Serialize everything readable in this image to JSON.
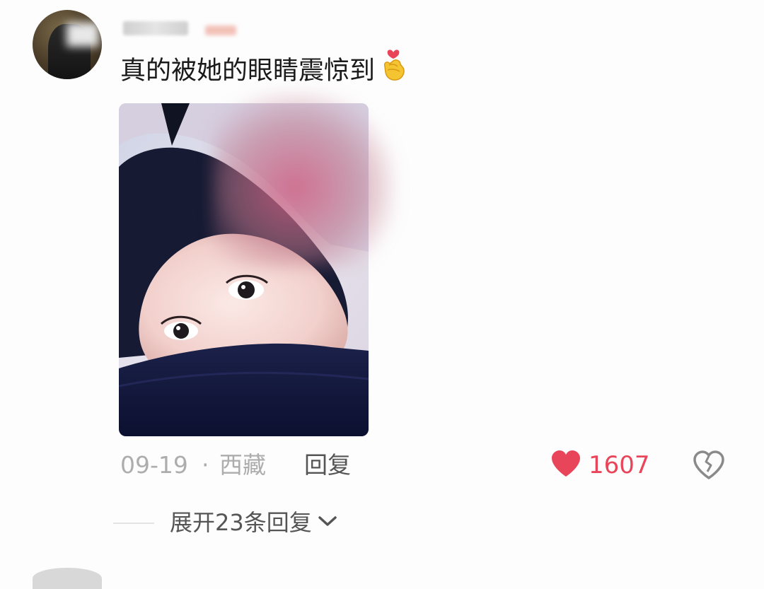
{
  "comment": {
    "text": "真的被她的眼睛震惊到",
    "emoji": "finger-heart-emoji",
    "date": "09-19",
    "separator": "·",
    "location": "西藏",
    "reply_label": "回复",
    "like_count": "1607",
    "expand_label": "展开23条回复"
  },
  "colors": {
    "like_red": "#e9455a",
    "meta_gray": "#adadad",
    "action_gray": "#555555"
  },
  "icons": {
    "like": "heart-icon",
    "dislike": "broken-heart-icon",
    "expand": "chevron-down-icon"
  }
}
